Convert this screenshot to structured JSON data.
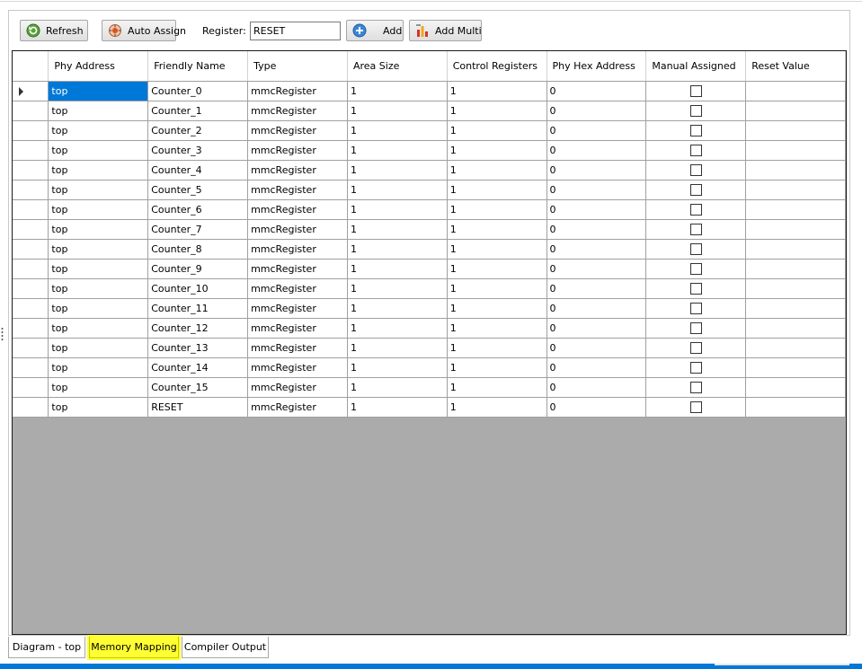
{
  "toolbar": {
    "refresh_label": "Refresh",
    "auto_assign_label": "Auto Assign",
    "register_label": "Register:",
    "register_value": "RESET",
    "add_label": "Add",
    "add_multi_label": "Add Multi"
  },
  "grid": {
    "columns": [
      "Phy Address",
      "Friendly Name",
      "Type",
      "Area Size",
      "Control Registers",
      "Phy Hex Address",
      "Manual Assigned",
      "Reset Value"
    ],
    "rows": [
      {
        "phy": "top",
        "name": "Counter_0",
        "type": "mmcRegister",
        "area": "1",
        "ctrl": "1",
        "hex": "0",
        "manual": false,
        "reset": ""
      },
      {
        "phy": "top",
        "name": "Counter_1",
        "type": "mmcRegister",
        "area": "1",
        "ctrl": "1",
        "hex": "0",
        "manual": false,
        "reset": ""
      },
      {
        "phy": "top",
        "name": "Counter_2",
        "type": "mmcRegister",
        "area": "1",
        "ctrl": "1",
        "hex": "0",
        "manual": false,
        "reset": ""
      },
      {
        "phy": "top",
        "name": "Counter_3",
        "type": "mmcRegister",
        "area": "1",
        "ctrl": "1",
        "hex": "0",
        "manual": false,
        "reset": ""
      },
      {
        "phy": "top",
        "name": "Counter_4",
        "type": "mmcRegister",
        "area": "1",
        "ctrl": "1",
        "hex": "0",
        "manual": false,
        "reset": ""
      },
      {
        "phy": "top",
        "name": "Counter_5",
        "type": "mmcRegister",
        "area": "1",
        "ctrl": "1",
        "hex": "0",
        "manual": false,
        "reset": ""
      },
      {
        "phy": "top",
        "name": "Counter_6",
        "type": "mmcRegister",
        "area": "1",
        "ctrl": "1",
        "hex": "0",
        "manual": false,
        "reset": ""
      },
      {
        "phy": "top",
        "name": "Counter_7",
        "type": "mmcRegister",
        "area": "1",
        "ctrl": "1",
        "hex": "0",
        "manual": false,
        "reset": ""
      },
      {
        "phy": "top",
        "name": "Counter_8",
        "type": "mmcRegister",
        "area": "1",
        "ctrl": "1",
        "hex": "0",
        "manual": false,
        "reset": ""
      },
      {
        "phy": "top",
        "name": "Counter_9",
        "type": "mmcRegister",
        "area": "1",
        "ctrl": "1",
        "hex": "0",
        "manual": false,
        "reset": ""
      },
      {
        "phy": "top",
        "name": "Counter_10",
        "type": "mmcRegister",
        "area": "1",
        "ctrl": "1",
        "hex": "0",
        "manual": false,
        "reset": ""
      },
      {
        "phy": "top",
        "name": "Counter_11",
        "type": "mmcRegister",
        "area": "1",
        "ctrl": "1",
        "hex": "0",
        "manual": false,
        "reset": ""
      },
      {
        "phy": "top",
        "name": "Counter_12",
        "type": "mmcRegister",
        "area": "1",
        "ctrl": "1",
        "hex": "0",
        "manual": false,
        "reset": ""
      },
      {
        "phy": "top",
        "name": "Counter_13",
        "type": "mmcRegister",
        "area": "1",
        "ctrl": "1",
        "hex": "0",
        "manual": false,
        "reset": ""
      },
      {
        "phy": "top",
        "name": "Counter_14",
        "type": "mmcRegister",
        "area": "1",
        "ctrl": "1",
        "hex": "0",
        "manual": false,
        "reset": ""
      },
      {
        "phy": "top",
        "name": "Counter_15",
        "type": "mmcRegister",
        "area": "1",
        "ctrl": "1",
        "hex": "0",
        "manual": false,
        "reset": ""
      },
      {
        "phy": "top",
        "name": "RESET",
        "type": "mmcRegister",
        "area": "1",
        "ctrl": "1",
        "hex": "0",
        "manual": false,
        "reset": ""
      }
    ]
  },
  "tabs": [
    {
      "label": "Diagram - top",
      "active": false
    },
    {
      "label": "Memory Mapping",
      "active": true
    },
    {
      "label": "Compiler Output",
      "active": false
    }
  ],
  "colors": {
    "selection": "#0078d7",
    "active_tab_highlight": "#ffff33",
    "grid_empty_area": "#ababab"
  },
  "icons": [
    "refresh-icon",
    "auto-assign-icon",
    "add-icon",
    "add-multi-icon",
    "row-pointer-icon",
    "checkbox-icon"
  ]
}
